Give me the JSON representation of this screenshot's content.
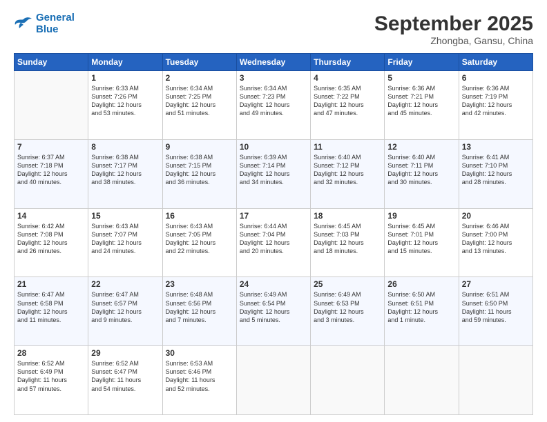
{
  "logo": {
    "line1": "General",
    "line2": "Blue"
  },
  "title": "September 2025",
  "subtitle": "Zhongba, Gansu, China",
  "days_header": [
    "Sunday",
    "Monday",
    "Tuesday",
    "Wednesday",
    "Thursday",
    "Friday",
    "Saturday"
  ],
  "weeks": [
    [
      {
        "num": "",
        "text": ""
      },
      {
        "num": "1",
        "text": "Sunrise: 6:33 AM\nSunset: 7:26 PM\nDaylight: 12 hours\nand 53 minutes."
      },
      {
        "num": "2",
        "text": "Sunrise: 6:34 AM\nSunset: 7:25 PM\nDaylight: 12 hours\nand 51 minutes."
      },
      {
        "num": "3",
        "text": "Sunrise: 6:34 AM\nSunset: 7:23 PM\nDaylight: 12 hours\nand 49 minutes."
      },
      {
        "num": "4",
        "text": "Sunrise: 6:35 AM\nSunset: 7:22 PM\nDaylight: 12 hours\nand 47 minutes."
      },
      {
        "num": "5",
        "text": "Sunrise: 6:36 AM\nSunset: 7:21 PM\nDaylight: 12 hours\nand 45 minutes."
      },
      {
        "num": "6",
        "text": "Sunrise: 6:36 AM\nSunset: 7:19 PM\nDaylight: 12 hours\nand 42 minutes."
      }
    ],
    [
      {
        "num": "7",
        "text": "Sunrise: 6:37 AM\nSunset: 7:18 PM\nDaylight: 12 hours\nand 40 minutes."
      },
      {
        "num": "8",
        "text": "Sunrise: 6:38 AM\nSunset: 7:17 PM\nDaylight: 12 hours\nand 38 minutes."
      },
      {
        "num": "9",
        "text": "Sunrise: 6:38 AM\nSunset: 7:15 PM\nDaylight: 12 hours\nand 36 minutes."
      },
      {
        "num": "10",
        "text": "Sunrise: 6:39 AM\nSunset: 7:14 PM\nDaylight: 12 hours\nand 34 minutes."
      },
      {
        "num": "11",
        "text": "Sunrise: 6:40 AM\nSunset: 7:12 PM\nDaylight: 12 hours\nand 32 minutes."
      },
      {
        "num": "12",
        "text": "Sunrise: 6:40 AM\nSunset: 7:11 PM\nDaylight: 12 hours\nand 30 minutes."
      },
      {
        "num": "13",
        "text": "Sunrise: 6:41 AM\nSunset: 7:10 PM\nDaylight: 12 hours\nand 28 minutes."
      }
    ],
    [
      {
        "num": "14",
        "text": "Sunrise: 6:42 AM\nSunset: 7:08 PM\nDaylight: 12 hours\nand 26 minutes."
      },
      {
        "num": "15",
        "text": "Sunrise: 6:43 AM\nSunset: 7:07 PM\nDaylight: 12 hours\nand 24 minutes."
      },
      {
        "num": "16",
        "text": "Sunrise: 6:43 AM\nSunset: 7:05 PM\nDaylight: 12 hours\nand 22 minutes."
      },
      {
        "num": "17",
        "text": "Sunrise: 6:44 AM\nSunset: 7:04 PM\nDaylight: 12 hours\nand 20 minutes."
      },
      {
        "num": "18",
        "text": "Sunrise: 6:45 AM\nSunset: 7:03 PM\nDaylight: 12 hours\nand 18 minutes."
      },
      {
        "num": "19",
        "text": "Sunrise: 6:45 AM\nSunset: 7:01 PM\nDaylight: 12 hours\nand 15 minutes."
      },
      {
        "num": "20",
        "text": "Sunrise: 6:46 AM\nSunset: 7:00 PM\nDaylight: 12 hours\nand 13 minutes."
      }
    ],
    [
      {
        "num": "21",
        "text": "Sunrise: 6:47 AM\nSunset: 6:58 PM\nDaylight: 12 hours\nand 11 minutes."
      },
      {
        "num": "22",
        "text": "Sunrise: 6:47 AM\nSunset: 6:57 PM\nDaylight: 12 hours\nand 9 minutes."
      },
      {
        "num": "23",
        "text": "Sunrise: 6:48 AM\nSunset: 6:56 PM\nDaylight: 12 hours\nand 7 minutes."
      },
      {
        "num": "24",
        "text": "Sunrise: 6:49 AM\nSunset: 6:54 PM\nDaylight: 12 hours\nand 5 minutes."
      },
      {
        "num": "25",
        "text": "Sunrise: 6:49 AM\nSunset: 6:53 PM\nDaylight: 12 hours\nand 3 minutes."
      },
      {
        "num": "26",
        "text": "Sunrise: 6:50 AM\nSunset: 6:51 PM\nDaylight: 12 hours\nand 1 minute."
      },
      {
        "num": "27",
        "text": "Sunrise: 6:51 AM\nSunset: 6:50 PM\nDaylight: 11 hours\nand 59 minutes."
      }
    ],
    [
      {
        "num": "28",
        "text": "Sunrise: 6:52 AM\nSunset: 6:49 PM\nDaylight: 11 hours\nand 57 minutes."
      },
      {
        "num": "29",
        "text": "Sunrise: 6:52 AM\nSunset: 6:47 PM\nDaylight: 11 hours\nand 54 minutes."
      },
      {
        "num": "30",
        "text": "Sunrise: 6:53 AM\nSunset: 6:46 PM\nDaylight: 11 hours\nand 52 minutes."
      },
      {
        "num": "",
        "text": ""
      },
      {
        "num": "",
        "text": ""
      },
      {
        "num": "",
        "text": ""
      },
      {
        "num": "",
        "text": ""
      }
    ]
  ]
}
